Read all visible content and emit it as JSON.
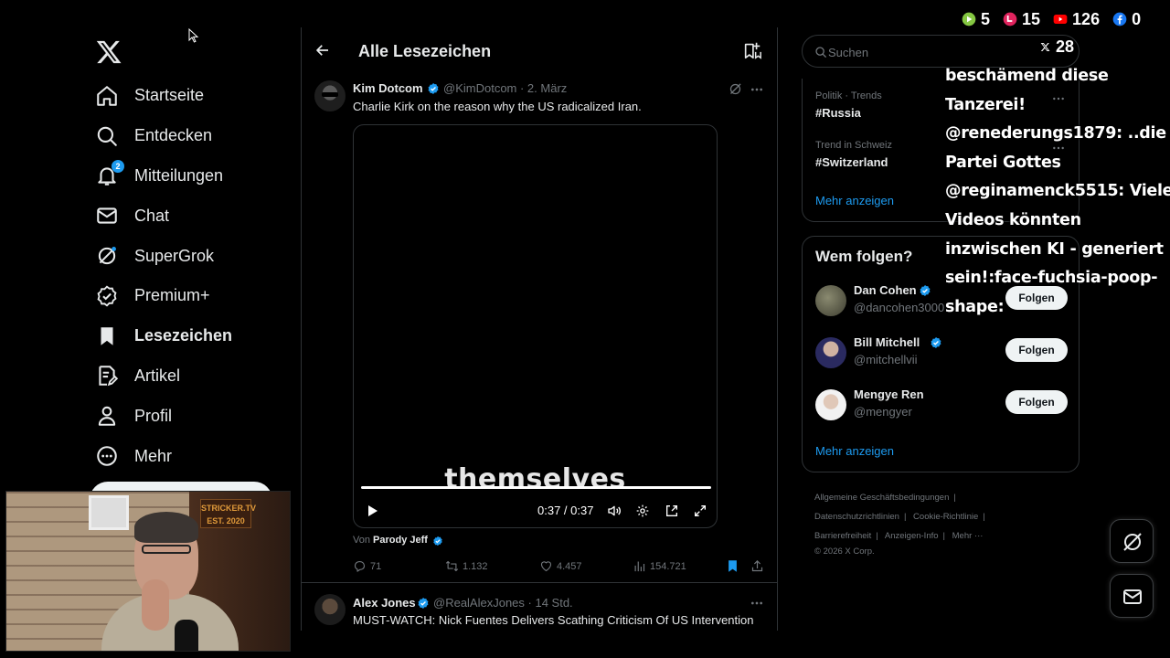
{
  "nav": {
    "items": [
      {
        "label": "Startseite"
      },
      {
        "label": "Entdecken"
      },
      {
        "label": "Mitteilungen",
        "badge": "2"
      },
      {
        "label": "Chat"
      },
      {
        "label": "SuperGrok"
      },
      {
        "label": "Premium+"
      },
      {
        "label": "Lesezeichen",
        "active": true
      },
      {
        "label": "Artikel"
      },
      {
        "label": "Profil"
      },
      {
        "label": "Mehr"
      }
    ]
  },
  "webcam": {
    "sign_line1": "STRICKER.TV",
    "sign_line2": "EST. 2020"
  },
  "header": {
    "title": "Alle Lesezeichen"
  },
  "tweet1": {
    "name": "Kim Dotcom",
    "handle": "@KimDotcom · 2. März",
    "text": "Charlie Kirk on the reason why the US radicalized Iran.",
    "video": {
      "caption": "themselves",
      "time": "0:37 / 0:37",
      "progress_fraction": 1.0
    },
    "from_label": "Von",
    "from_name": "Parody Jeff",
    "replies": "71",
    "reposts": "1.132",
    "likes": "4.457",
    "views": "154.721"
  },
  "tweet2": {
    "name": "Alex Jones",
    "handle": "@RealAlexJones · 14 Std.",
    "text": "MUST-WATCH: Nick Fuentes Delivers Scathing Criticism Of US Intervention"
  },
  "search": {
    "placeholder": "Suchen"
  },
  "trends": {
    "items": [
      {
        "meta": "Politik · Trends",
        "name": "#Russia"
      },
      {
        "meta": "Trend in Schweiz",
        "name": "#Switzerland"
      }
    ],
    "show_more": "Mehr anzeigen"
  },
  "who_to_follow": {
    "title": "Wem folgen?",
    "users": [
      {
        "name": "Dan Cohen",
        "handle": "@dancohen3000",
        "verified": true,
        "button": "Folgen"
      },
      {
        "name": "Bill Mitchell",
        "handle": "@mitchellvii",
        "verified": true,
        "button": "Folgen"
      },
      {
        "name": "Mengye Ren",
        "handle": "@mengyer",
        "verified": false,
        "button": "Folgen"
      }
    ],
    "show_more": "Mehr anzeigen"
  },
  "footer": {
    "links": [
      "Allgemeine Geschäftsbedingungen",
      "Datenschutzrichtlinien",
      "Cookie-Richtlinie",
      "Barrierefreiheit",
      "Anzeigen-Info",
      "Mehr ···"
    ],
    "copyright": "© 2026 X Corp."
  },
  "overlay": {
    "counters": [
      {
        "platform": "rumble",
        "value": "5",
        "color": "#85c742"
      },
      {
        "platform": "live",
        "value": "15",
        "color": "#e0245e"
      },
      {
        "platform": "youtube",
        "value": "126",
        "color": "#ff0000"
      },
      {
        "platform": "facebook",
        "value": "0",
        "color": "#1877f2"
      }
    ],
    "x_count": "28",
    "chat_lines": [
      "beschämend diese",
      "Tanzerei!",
      "@renederungs1879: ..die",
      "Partei Gottes",
      "@reginamenck5515: Viele",
      "Videos könnten",
      "inzwischen KI - generiert",
      "sein!:face-fuchsia-poop-",
      "shape:"
    ]
  },
  "colors": {
    "accent": "#1d9bf0",
    "background": "#000000",
    "border": "#2f3336",
    "muted": "#71767b"
  }
}
